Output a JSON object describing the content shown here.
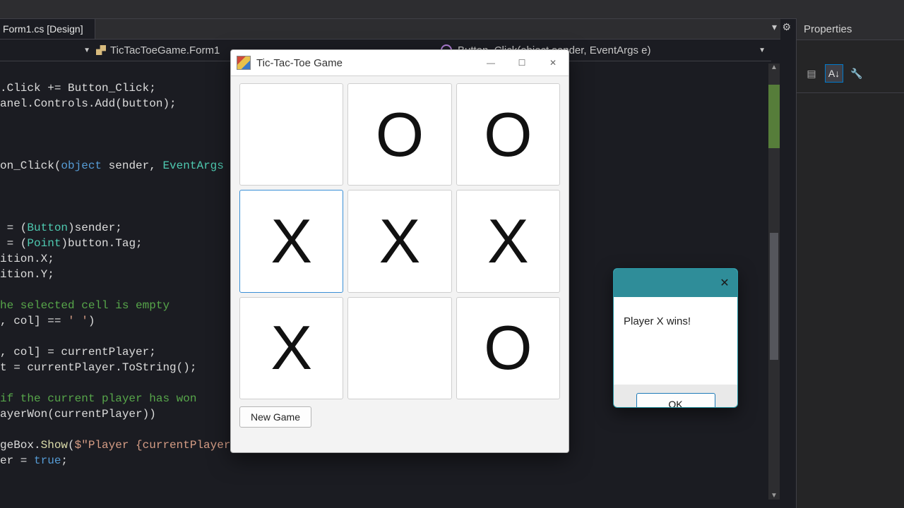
{
  "ide": {
    "tab_label": "Form1.cs [Design]",
    "nav_left_class": "TicTacToeGame.Form1",
    "nav_right_method": "Button_Click(object sender, EventArgs e)",
    "properties_title": "Properties"
  },
  "code_lines": [
    {
      "t": ".Click += Button_Click;",
      "c": ""
    },
    {
      "t": "anel.Controls.Add(button);",
      "c": ""
    },
    {
      "t": "",
      "c": ""
    },
    {
      "t": "",
      "c": ""
    },
    {
      "t": "",
      "c": ""
    },
    {
      "t": "on_Click(object sender, EventArgs e",
      "c": "sig"
    },
    {
      "t": "",
      "c": ""
    },
    {
      "t": "",
      "c": ""
    },
    {
      "t": "",
      "c": ""
    },
    {
      "t": " = (Button)sender;",
      "c": "cast1"
    },
    {
      "t": " = (Point)button.Tag;",
      "c": "cast2"
    },
    {
      "t": "ition.X;",
      "c": ""
    },
    {
      "t": "ition.Y;",
      "c": ""
    },
    {
      "t": "",
      "c": ""
    },
    {
      "t": "he selected cell is empty",
      "c": "cmt"
    },
    {
      "t": ", col] == ' ')",
      "c": "cond"
    },
    {
      "t": "",
      "c": ""
    },
    {
      "t": ", col] = currentPlayer;",
      "c": ""
    },
    {
      "t": "t = currentPlayer.ToString();",
      "c": ""
    },
    {
      "t": "",
      "c": ""
    },
    {
      "t": "if the current player has won",
      "c": "cmt"
    },
    {
      "t": "ayerWon(currentPlayer))",
      "c": ""
    },
    {
      "t": "",
      "c": ""
    },
    {
      "t": "geBox.Show($\"Player {currentPlayer} wins!\");",
      "c": "msg"
    },
    {
      "t": "er = true;",
      "c": "bool"
    }
  ],
  "window": {
    "title": "Tic-Tac-Toe Game",
    "cells": [
      "",
      "O",
      "O",
      "X",
      "X",
      "X",
      "X",
      "",
      "O"
    ],
    "selected_index": 3,
    "new_game": "New Game"
  },
  "dialog": {
    "message": "Player X wins!",
    "ok": "OK"
  }
}
